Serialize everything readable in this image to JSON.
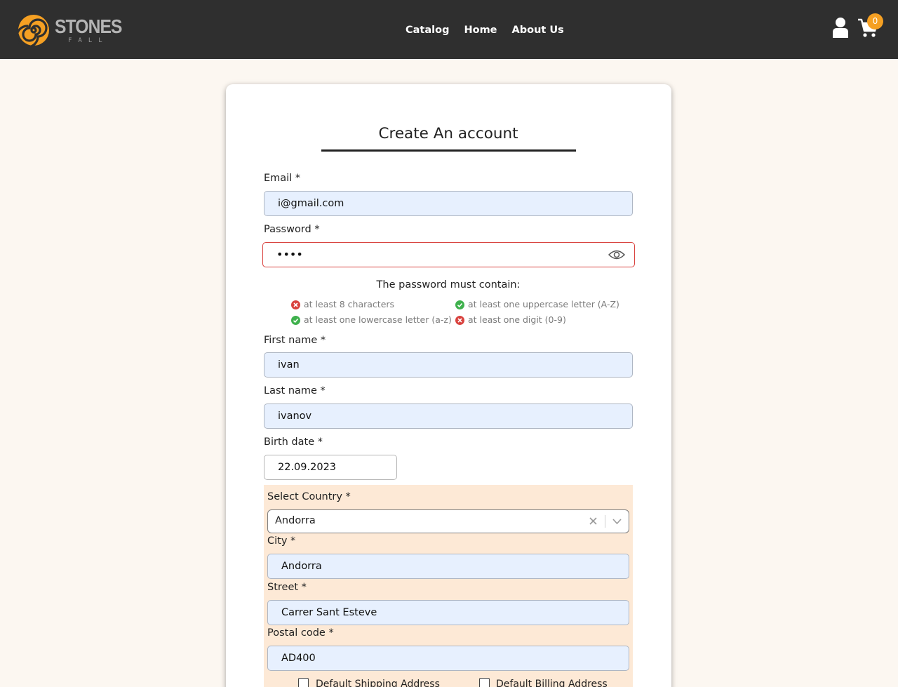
{
  "header": {
    "logo_text": "STONES",
    "logo_sub": "FALL",
    "nav": [
      "Catalog",
      "Home",
      "About Us"
    ],
    "cart_count": "0",
    "colors": {
      "bar": "#2f2f2f",
      "accent": "#f5a023"
    }
  },
  "form": {
    "title": "Create An account",
    "email_label": "Email *",
    "email_value": "i@gmail.com",
    "password_label": "Password *",
    "password_value": "••••",
    "password_hint": "The password must contain:",
    "rules": [
      {
        "text": "at least 8 characters",
        "ok": false
      },
      {
        "text": "at least one uppercase letter (A-Z)",
        "ok": true
      },
      {
        "text": "at least one lowercase letter (a-z)",
        "ok": true
      },
      {
        "text": "at least one digit (0-9)",
        "ok": false
      }
    ],
    "first_name_label": "First name *",
    "first_name_value": "ivan",
    "last_name_label": "Last name *",
    "last_name_value": "ivanov",
    "birth_label": "Birth date *",
    "birth_value": "22.09.2023",
    "address": {
      "country_label": "Select Country *",
      "country_value": "Andorra",
      "city_label": "City *",
      "city_value": "Andorra",
      "street_label": "Street *",
      "street_value": "Carrer Sant Esteve",
      "postal_label": "Postal code *",
      "postal_value": "AD400",
      "default_shipping": "Default Shipping Address",
      "default_billing": "Default Billing Address"
    }
  }
}
